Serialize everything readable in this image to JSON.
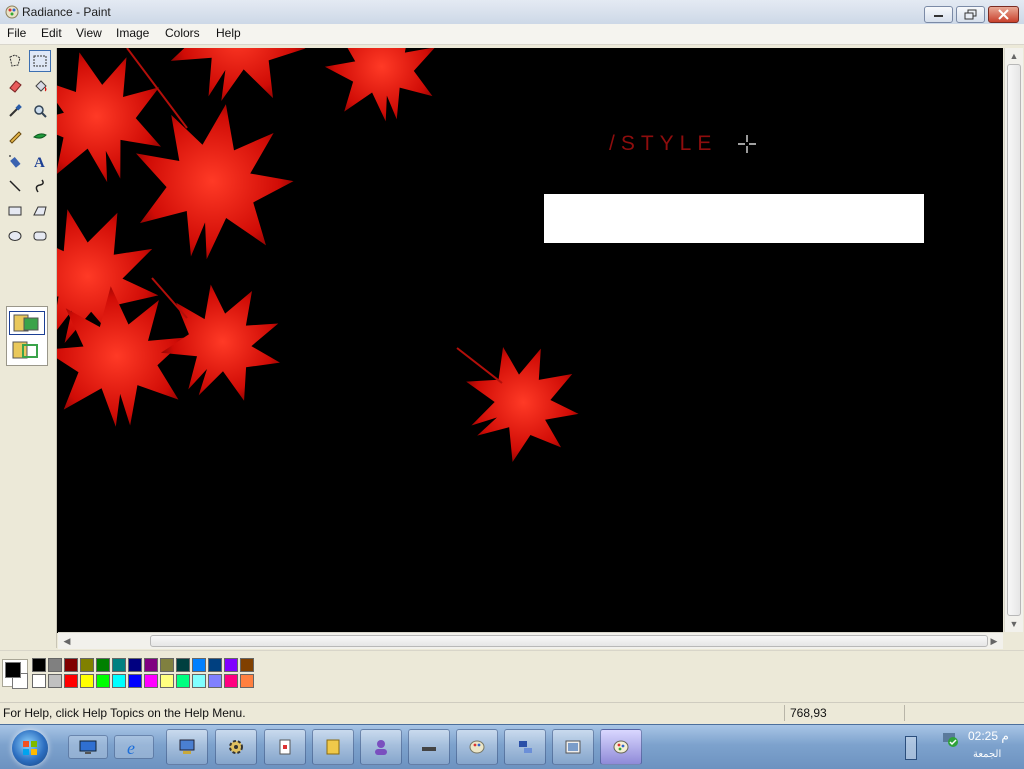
{
  "window": {
    "title": "Radiance - Paint"
  },
  "menu": [
    "File",
    "Edit",
    "View",
    "Image",
    "Colors",
    "Help"
  ],
  "tools": [
    {
      "name": "free-form-select-icon",
      "selected": false
    },
    {
      "name": "rectangle-select-icon",
      "selected": true
    },
    {
      "name": "eraser-icon",
      "selected": false
    },
    {
      "name": "fill-bucket-icon",
      "selected": false
    },
    {
      "name": "color-picker-icon",
      "selected": false
    },
    {
      "name": "magnifier-icon",
      "selected": false
    },
    {
      "name": "pencil-icon",
      "selected": false
    },
    {
      "name": "brush-icon",
      "selected": false
    },
    {
      "name": "airbrush-icon",
      "selected": false
    },
    {
      "name": "text-icon",
      "selected": false
    },
    {
      "name": "line-icon",
      "selected": false
    },
    {
      "name": "curve-icon",
      "selected": false
    },
    {
      "name": "rectangle-icon",
      "selected": false
    },
    {
      "name": "polygon-icon",
      "selected": false
    },
    {
      "name": "ellipse-icon",
      "selected": false
    },
    {
      "name": "rounded-rectangle-icon",
      "selected": false
    }
  ],
  "canvas": {
    "text": "/STYLE"
  },
  "colors": {
    "foreground": "#000000",
    "background": "#ffffff",
    "palette_top": [
      "#000000",
      "#808080",
      "#800000",
      "#808000",
      "#008000",
      "#008080",
      "#000080",
      "#800080",
      "#808040",
      "#004040",
      "#0080ff",
      "#004080",
      "#8000ff",
      "#804000"
    ],
    "palette_bottom": [
      "#ffffff",
      "#c0c0c0",
      "#ff0000",
      "#ffff00",
      "#00ff00",
      "#00ffff",
      "#0000ff",
      "#ff00ff",
      "#ffff80",
      "#00ff80",
      "#80ffff",
      "#8080ff",
      "#ff0080",
      "#ff8040"
    ]
  },
  "status": {
    "help": "For Help, click Help Topics on the Help Menu.",
    "coords": "768,93"
  },
  "taskbar": {
    "time": "02:25 م",
    "date": "الجمعة"
  }
}
